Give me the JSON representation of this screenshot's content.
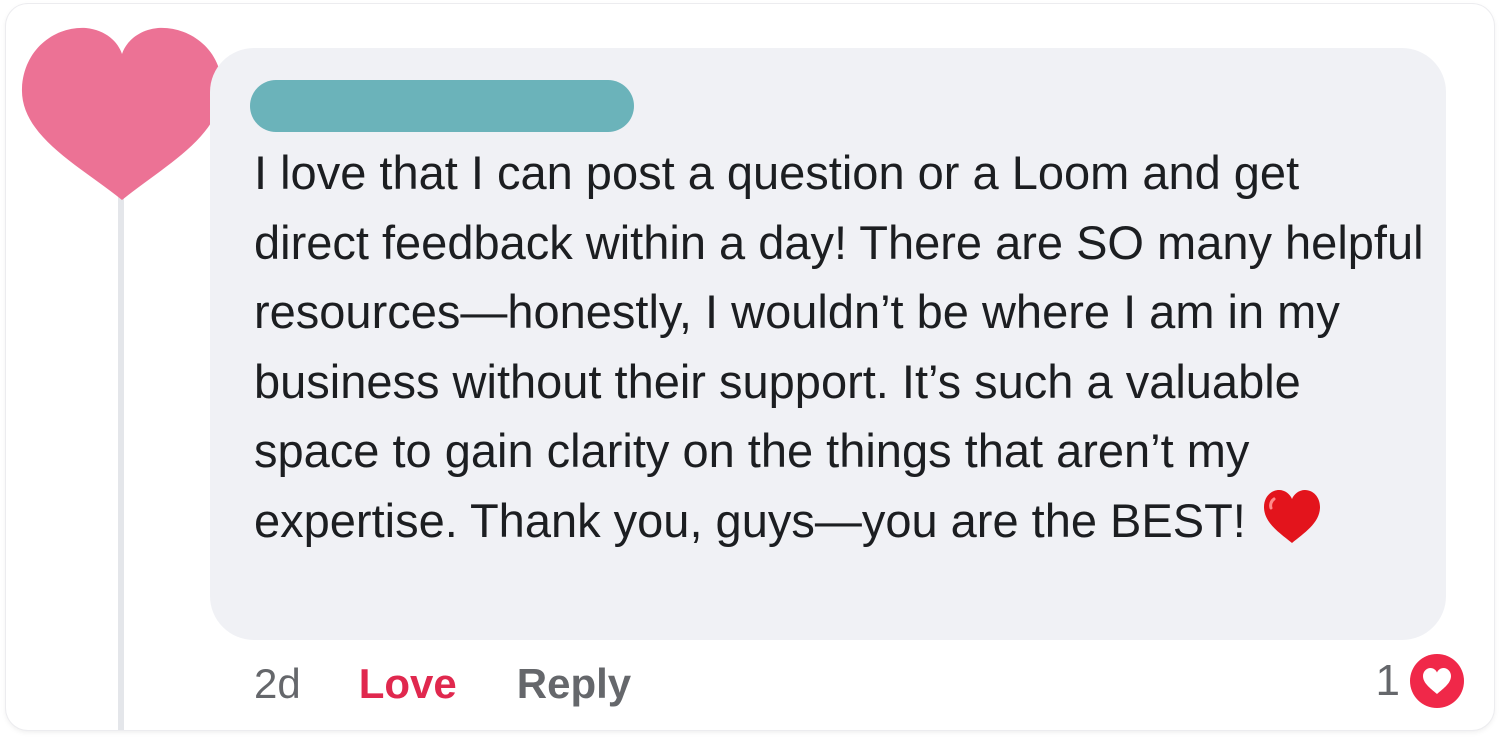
{
  "comment": {
    "text": "I love that I can post a question or a Loom and get direct feedback within a day! There are SO many helpful resources—honestly, I wouldn’t be where I am in my business without their support. It’s such a valuable space to gain clarity on the things that aren’t my expertise. Thank you, guys—you are the BEST!",
    "emoji": "red-heart-icon"
  },
  "actions": {
    "timestamp": "2d",
    "love_label": "Love",
    "reply_label": "Reply"
  },
  "reactions": {
    "count": "1",
    "icon": "love-reaction-icon"
  },
  "colors": {
    "avatar": "#ec7295",
    "name_redaction": "#6bb3ba",
    "bubble": "#f0f1f5",
    "love_accent": "#e0284e",
    "muted_text": "#65676b"
  }
}
